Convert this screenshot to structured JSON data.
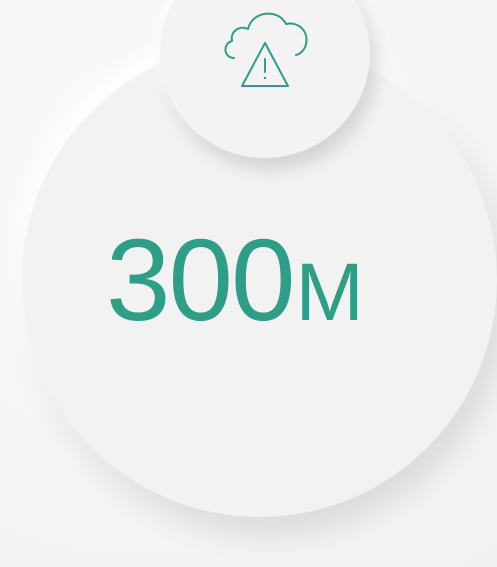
{
  "metric": {
    "value": "300",
    "unit": "M"
  },
  "icon": {
    "name": "cloud-warning-icon"
  },
  "colors": {
    "accent": "#2e9e86",
    "circle_fill": "#f2f2f2",
    "background": "#f5f5f5"
  }
}
